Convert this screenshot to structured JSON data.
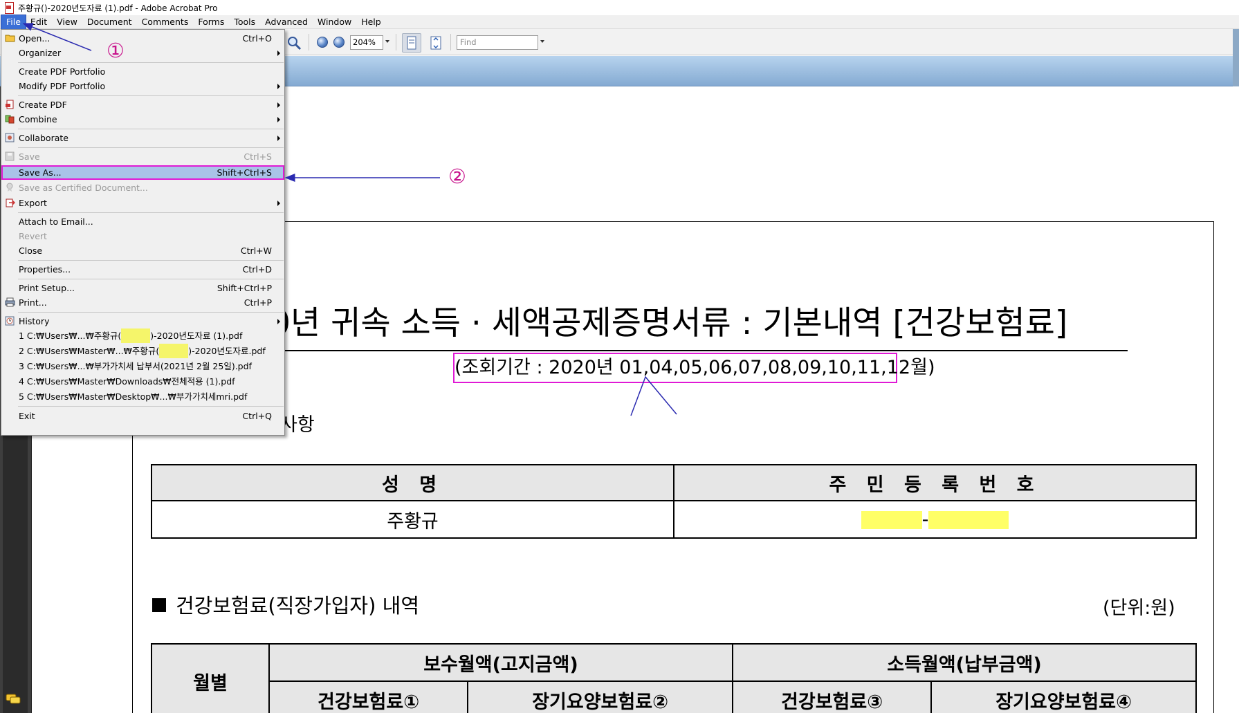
{
  "window": {
    "title_prefix": "주황규(",
    "title_redacted": "        ",
    "title_suffix": ")-2020년도자료 (1).pdf - Adobe Acrobat Pro"
  },
  "menubar": {
    "items": [
      "File",
      "Edit",
      "View",
      "Document",
      "Comments",
      "Forms",
      "Tools",
      "Advanced",
      "Window",
      "Help"
    ]
  },
  "toolbar": {
    "zoom_value": "204%",
    "find_placeholder": "Find"
  },
  "file_menu": {
    "items": [
      {
        "label": "Open...",
        "shortcut": "Ctrl+O",
        "icon": "folder-icon"
      },
      {
        "label": "Organizer",
        "shortcut": "",
        "submenu": true
      },
      {
        "label": "Create PDF Portfolio",
        "shortcut": ""
      },
      {
        "label": "Modify PDF Portfolio",
        "shortcut": "",
        "submenu": true
      },
      {
        "label": "Create PDF",
        "shortcut": "",
        "submenu": true,
        "icon": "create-pdf-icon"
      },
      {
        "label": "Combine",
        "shortcut": "",
        "submenu": true,
        "icon": "combine-icon"
      },
      {
        "label": "Collaborate",
        "shortcut": "",
        "submenu": true,
        "icon": "collaborate-icon"
      },
      {
        "label": "Save",
        "shortcut": "Ctrl+S",
        "disabled": true,
        "icon": "save-icon"
      },
      {
        "label": "Save As...",
        "shortcut": "Shift+Ctrl+S",
        "selected": true
      },
      {
        "label": "Save as Certified Document...",
        "shortcut": "",
        "disabled": true,
        "icon": "certify-icon"
      },
      {
        "label": "Export",
        "shortcut": "",
        "submenu": true,
        "icon": "export-icon"
      },
      {
        "label": "Attach to Email...",
        "shortcut": ""
      },
      {
        "label": "Revert",
        "shortcut": "",
        "disabled": true
      },
      {
        "label": "Close",
        "shortcut": "Ctrl+W"
      },
      {
        "label": "Properties...",
        "shortcut": "Ctrl+D"
      },
      {
        "label": "Print Setup...",
        "shortcut": "Shift+Ctrl+P"
      },
      {
        "label": "Print...",
        "shortcut": "Ctrl+P",
        "icon": "printer-icon"
      },
      {
        "label": "History",
        "shortcut": "",
        "submenu": true,
        "icon": "history-icon"
      },
      {
        "label": "Exit",
        "shortcut": "Ctrl+Q"
      }
    ],
    "recent_files": [
      {
        "prefix": "1 C:₩Users₩...₩주황규(",
        "redacted": true,
        "suffix": ")-2020년도자료 (1).pdf"
      },
      {
        "prefix": "2 C:₩Users₩Master₩...₩주황규(",
        "redacted": true,
        "suffix": ")-2020년도자료.pdf"
      },
      {
        "prefix": "3 C:₩Users₩...₩부가가치세 납부서(2021년 2월 25일).pdf",
        "redacted": false,
        "suffix": ""
      },
      {
        "prefix": "4 C:₩Users₩Master₩Downloads₩전체적용 (1).pdf",
        "redacted": false,
        "suffix": ""
      },
      {
        "prefix": "5 C:₩Users₩Master₩Desktop₩...₩부가가치세mri.pdf",
        "redacted": false,
        "suffix": ""
      }
    ]
  },
  "annotations": {
    "step1": "①",
    "step2": "②"
  },
  "document": {
    "title": "0년 귀속 소득 · 세액공제증명서류 : 기본내역 [건강보험료]",
    "period": "(조회기간 : 2020년 01,04,05,06,07,08,09,10,11,12월)",
    "section_fragment": "사항",
    "info_table": {
      "headers": [
        "성 명",
        "주 민 등 록 번 호"
      ],
      "name": "주황규",
      "id_separator": "-"
    },
    "health_section": "건강보험료(직장가입자) 내역",
    "unit": "(단위:원)",
    "detail_table": {
      "row_header": "월별",
      "group1": "보수월액(고지금액)",
      "group2": "소득월액(납부금액)",
      "sub": [
        "건강보험료①",
        "장기요양보험료②",
        "건강보험료③",
        "장기요양보험료④"
      ]
    }
  },
  "colors": {
    "annotation_magenta": "#e01ad5",
    "annotation_arrow": "#2a2ab0",
    "menu_selected": "#a9c3e8",
    "redaction_yellow": "#ffff66",
    "toolbar_blue_band": "#a7c6e6"
  }
}
